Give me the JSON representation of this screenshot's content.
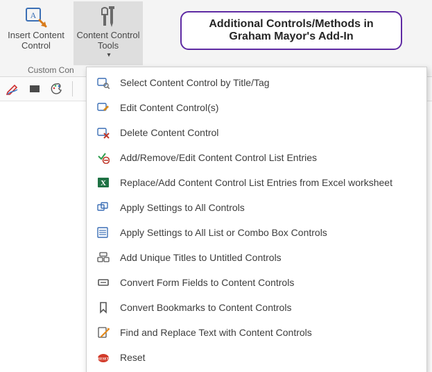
{
  "ribbon": {
    "insert_content_control": {
      "label": "Insert Content\nControl"
    },
    "content_control_tools": {
      "label": "Content Control\nTools",
      "has_dropdown": true
    },
    "group_label": "Custom Con"
  },
  "callout": {
    "text": "Additional Controls/Methods in Graham Mayor's Add-In"
  },
  "menu": {
    "items": [
      {
        "icon": "select-icon",
        "label": "Select Content Control by Title/Tag"
      },
      {
        "icon": "edit-icon",
        "label": "Edit Content Control(s)"
      },
      {
        "icon": "delete-icon",
        "label": "Delete Content Control"
      },
      {
        "icon": "list-entries-icon",
        "label": "Add/Remove/Edit Content Control List Entries"
      },
      {
        "icon": "excel-icon",
        "label": "Replace/Add Content Control List Entries from Excel worksheet"
      },
      {
        "icon": "apply-all-icon",
        "label": "Apply Settings to All Controls"
      },
      {
        "icon": "apply-list-icon",
        "label": "Apply Settings to All List or Combo Box Controls"
      },
      {
        "icon": "unique-titles-icon",
        "label": "Add Unique Titles to Untitled Controls"
      },
      {
        "icon": "convert-form-icon",
        "label": "Convert Form Fields to Content Controls"
      },
      {
        "icon": "convert-bookmark-icon",
        "label": "Convert Bookmarks to Content Controls"
      },
      {
        "icon": "find-replace-icon",
        "label": "Find and Replace Text with Content Controls"
      },
      {
        "icon": "reset-icon",
        "label": "Reset"
      }
    ]
  }
}
